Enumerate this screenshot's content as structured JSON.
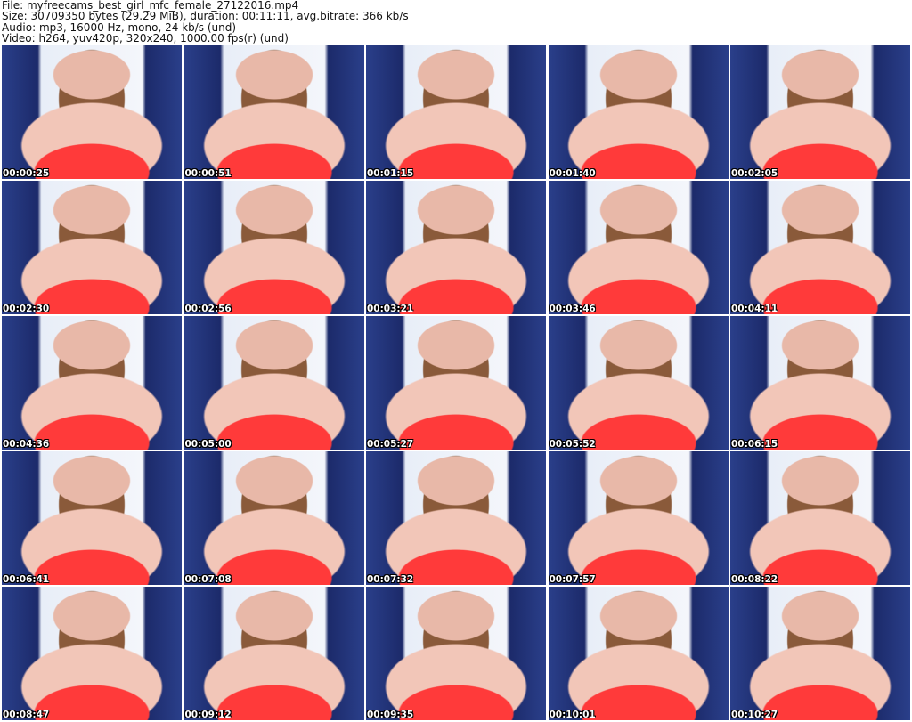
{
  "header": {
    "file": "File: myfreecams_best_girl_mfc_female_27122016.mp4",
    "size": "Size: 30709350 bytes (29.29 MiB), duration: 00:11:11, avg.bitrate: 366 kb/s",
    "audio": "Audio: mp3, 16000 Hz, mono, 24 kb/s (und)",
    "video": "Video: h264, yuv420p, 320x240, 1000.00 fps(r) (und)"
  },
  "thumbnails": [
    "00:00:25",
    "00:00:51",
    "00:01:15",
    "00:01:40",
    "00:02:05",
    "00:02:30",
    "00:02:56",
    "00:03:21",
    "00:03:46",
    "00:04:11",
    "00:04:36",
    "00:05:00",
    "00:05:27",
    "00:05:52",
    "00:06:15",
    "00:06:41",
    "00:07:08",
    "00:07:32",
    "00:07:57",
    "00:08:22",
    "00:08:47",
    "00:09:12",
    "00:09:35",
    "00:10:01",
    "00:10:27"
  ]
}
